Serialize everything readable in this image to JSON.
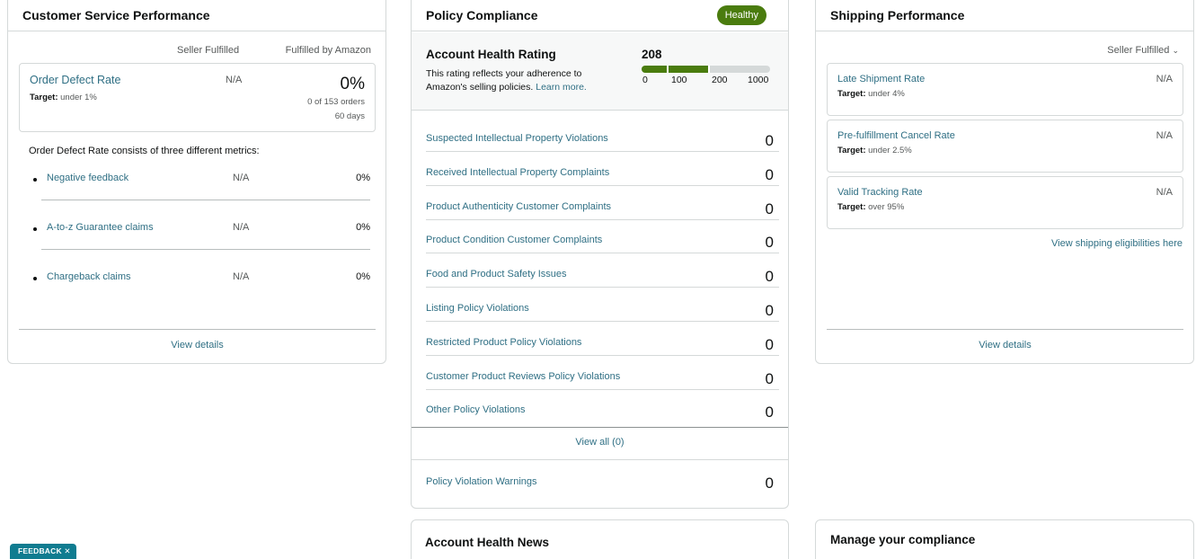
{
  "customer_service": {
    "title": "Customer Service Performance",
    "col_seller": "Seller Fulfilled",
    "col_amazon": "Fulfilled by Amazon",
    "odr": {
      "label": "Order Defect Rate",
      "target_label": "Target:",
      "target_value": "under 1%",
      "seller_value": "N/A",
      "amazon_value": "0%",
      "orders": "0 of 153 orders",
      "period": "60 days"
    },
    "description": "Order Defect Rate consists of three different metrics:",
    "metrics": [
      {
        "name": "Negative feedback",
        "seller": "N/A",
        "amazon": "0%"
      },
      {
        "name": "A-to-z Guarantee claims",
        "seller": "N/A",
        "amazon": "0%"
      },
      {
        "name": "Chargeback claims",
        "seller": "N/A",
        "amazon": "0%"
      }
    ],
    "view_details": "View details"
  },
  "policy": {
    "title": "Policy Compliance",
    "badge": "Healthy",
    "ahr_title": "Account Health Rating",
    "ahr_desc": "This rating reflects your adherence to Amazon's selling policies.",
    "ahr_learn_more": "Learn more.",
    "ahr_value": "208",
    "ahr_fraction": 0.208,
    "scale": [
      "0",
      "100",
      "200",
      "1000"
    ],
    "violations": [
      {
        "name": "Suspected Intellectual Property Violations",
        "count": "0"
      },
      {
        "name": "Received Intellectual Property Complaints",
        "count": "0"
      },
      {
        "name": "Product Authenticity Customer Complaints",
        "count": "0"
      },
      {
        "name": "Product Condition Customer Complaints",
        "count": "0"
      },
      {
        "name": "Food and Product Safety Issues",
        "count": "0"
      },
      {
        "name": "Listing Policy Violations",
        "count": "0"
      },
      {
        "name": "Restricted Product Policy Violations",
        "count": "0"
      },
      {
        "name": "Customer Product Reviews Policy Violations",
        "count": "0"
      },
      {
        "name": "Other Policy Violations",
        "count": "0"
      }
    ],
    "view_all": "View all (0)",
    "warnings": {
      "name": "Policy Violation Warnings",
      "count": "0"
    }
  },
  "shipping": {
    "title": "Shipping Performance",
    "filter": "Seller Fulfilled",
    "metrics": [
      {
        "name": "Late Shipment Rate",
        "target_label": "Target:",
        "target_value": "under 4%",
        "value": "N/A"
      },
      {
        "name": "Pre-fulfillment Cancel Rate",
        "target_label": "Target:",
        "target_value": "under 2.5%",
        "value": "N/A"
      },
      {
        "name": "Valid Tracking Rate",
        "target_label": "Target:",
        "target_value": "over 95%",
        "value": "N/A"
      }
    ],
    "eligibility_link": "View shipping eligibilities here",
    "view_details": "View details"
  },
  "news": {
    "title": "Account Health News"
  },
  "manage": {
    "title": "Manage your compliance"
  },
  "feedback": {
    "label": "FEEDBACK",
    "close": "✕"
  },
  "colors": {
    "accent_green": "#4a7c0e",
    "link": "#2f6f84",
    "feedback_bg": "#0f7c90"
  }
}
